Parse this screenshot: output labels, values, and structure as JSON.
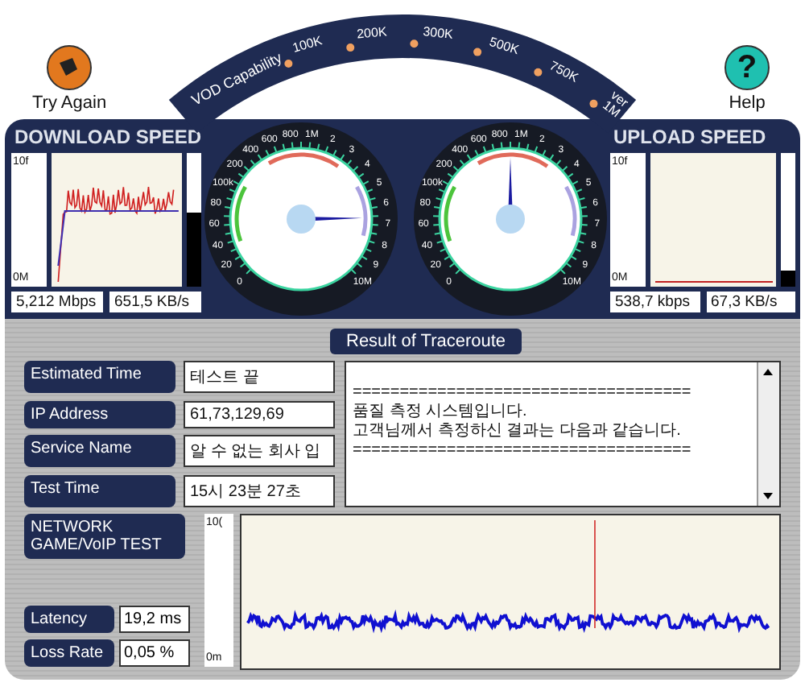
{
  "toolbar": {
    "try_again": {
      "label": "Try Again"
    },
    "help": {
      "label": "Help",
      "icon": "?"
    }
  },
  "vod": {
    "title": "VOD Capability",
    "marks": [
      "100K",
      "200K",
      "300K",
      "500K",
      "750K",
      "ver 1M"
    ]
  },
  "download": {
    "title": "DOWNLOAD SPEED",
    "axis_top": "10f",
    "axis_bottom": "0M",
    "bar": {
      "level": 0.45
    },
    "readings": [
      "5,212 Mbps",
      "651,5 KB/s"
    ]
  },
  "gauges": [
    {
      "level": 0.83,
      "left_labels": [
        "80",
        "60",
        "40",
        "20",
        "0"
      ],
      "labels": [
        "100k",
        "200",
        "400",
        "600",
        "800",
        "1M",
        "2",
        "3",
        "4",
        "5",
        "6",
        "7",
        "8",
        "9",
        "10M"
      ]
    },
    {
      "level": 0.5,
      "left_labels": [
        "80",
        "60",
        "40",
        "20",
        "0"
      ],
      "labels": [
        "100k",
        "200",
        "400",
        "600",
        "800",
        "1M",
        "2",
        "3",
        "4",
        "5",
        "6",
        "7",
        "8",
        "9",
        "10M"
      ]
    }
  ],
  "upload": {
    "title": "UPLOAD SPEED",
    "axis_top": "10f",
    "axis_bottom": "0M",
    "bar": {
      "level": 0.88
    },
    "readings": [
      "538,7 kbps",
      "67,3 KB/s"
    ]
  },
  "info": [
    {
      "label": "Estimated Time",
      "value": "테스트 끝"
    },
    {
      "label": "IP Address",
      "value": "61,73,129,69"
    },
    {
      "label": "Service Name",
      "value": "알 수 없는 회사 입"
    },
    {
      "label": "Test Time",
      "value": "15시 23분 27초"
    }
  ],
  "traceroute": {
    "title": "Result of Traceroute",
    "lines": [
      "====================================",
      "품질 측정 시스템입니다.",
      "고객님께서 측정하신 결과는 다음과 같습니다.",
      "===================================="
    ]
  },
  "network": {
    "title": "NETWORK GAME/VoIP TEST",
    "axis_top": "10(",
    "axis_bottom": "0m",
    "fields": [
      {
        "label": "Latency",
        "value": "19,2 ms"
      },
      {
        "label": "Loss Rate",
        "value": "0,05 %"
      }
    ]
  }
}
